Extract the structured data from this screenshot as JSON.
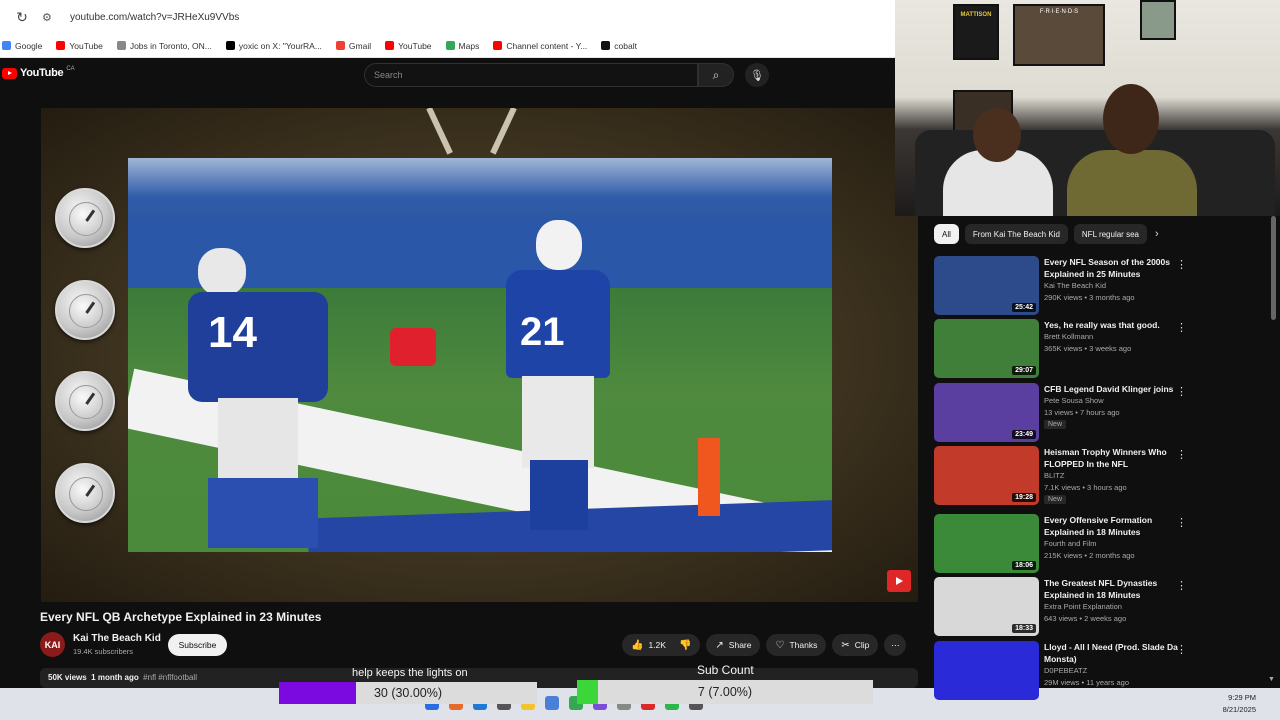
{
  "browser": {
    "url": "youtube.com/watch?v=JRHeXu9VVbs",
    "bookmarks": [
      {
        "label": "Google",
        "color": "#4285f4"
      },
      {
        "label": "YouTube",
        "color": "#ff0000"
      },
      {
        "label": "Jobs in Toronto, ON...",
        "color": "#888888"
      },
      {
        "label": "yoxic on X: \"YourRA...",
        "color": "#000000"
      },
      {
        "label": "Gmail",
        "color": "#ea4335"
      },
      {
        "label": "YouTube",
        "color": "#ff0000"
      },
      {
        "label": "Maps",
        "color": "#34a853"
      },
      {
        "label": "Channel content - Y...",
        "color": "#ff0000"
      },
      {
        "label": "cobalt",
        "color": "#111111"
      }
    ]
  },
  "youtube": {
    "logo_text": "YouTube",
    "region": "CA",
    "search_placeholder": "Search"
  },
  "video": {
    "title": "Every NFL QB Archetype Explained in 23 Minutes",
    "jersey_a": "21",
    "jersey_b": "14",
    "channel_avatar": "KAI",
    "channel_name": "Kai The Beach Kid",
    "subscribers": "19.4K subscribers",
    "subscribe_label": "Subscribe",
    "likes": "1.2K",
    "share_label": "Share",
    "thanks_label": "Thanks",
    "clip_label": "Clip",
    "views": "50K views",
    "age": "1 month ago",
    "tags": "#nfl #nflfootball"
  },
  "overlay": {
    "goal1_label": "help keeps the lights on",
    "goal1_text": "30 (30.00%)",
    "goal1_fraction": 0.3,
    "goal1_color": "#7a0ae0",
    "goal2_label": "Sub Count",
    "goal2_text": "7 (7.00%)",
    "goal2_fraction": 0.07,
    "goal2_color": "#3ad63a"
  },
  "sidebar": {
    "chips": [
      "All",
      "From Kai The Beach Kid",
      "NFL regular sea"
    ],
    "recommendations": [
      {
        "title": "Every NFL Season of the 2000s Explained in 25 Minutes",
        "channel": "Kai The Beach Kid",
        "meta": "290K views • 3 months ago",
        "duration": "25:42",
        "badge": "",
        "thumb_color": "#2d4a8a"
      },
      {
        "title": "Yes, he really was that good.",
        "channel": "Brett Kollmann",
        "meta": "365K views • 3 weeks ago",
        "duration": "29:07",
        "badge": "",
        "thumb_color": "#3f7f3a"
      },
      {
        "title": "CFB Legend David Klinger joins",
        "channel": "Pete Sousa Show",
        "meta": "13 views • 7 hours ago",
        "duration": "23:49",
        "badge": "New",
        "thumb_color": "#5a3fa0"
      },
      {
        "title": "Heisman Trophy Winners Who FLOPPED In the NFL",
        "channel": "BLITZ",
        "meta": "7.1K views • 3 hours ago",
        "duration": "19:28",
        "badge": "New",
        "thumb_color": "#c23a2a"
      },
      {
        "title": "Every Offensive Formation Explained in 18 Minutes",
        "channel": "Fourth and Film",
        "meta": "215K views • 2 months ago",
        "duration": "18:06",
        "badge": "",
        "thumb_color": "#3a8a3a"
      },
      {
        "title": "The Greatest NFL Dynasties Explained in 18 Minutes",
        "channel": "Extra Point Explanation",
        "meta": "643 views • 2 weeks ago",
        "duration": "18:33",
        "badge": "",
        "thumb_color": "#d8d8d8"
      },
      {
        "title": "Lloyd - All I Need (Prod. Slade Da Monsta)",
        "channel": "D0PEBEATZ",
        "meta": "29M views • 11 years ago",
        "duration": "",
        "badge": "",
        "thumb_color": "#2a2ad8"
      }
    ]
  },
  "cam": {
    "poster_text": "MATTISON",
    "friends_text": "F·R·I·E·N·D·S"
  },
  "taskbar": {
    "time": "9:29 PM",
    "date": "8/21/2025"
  }
}
